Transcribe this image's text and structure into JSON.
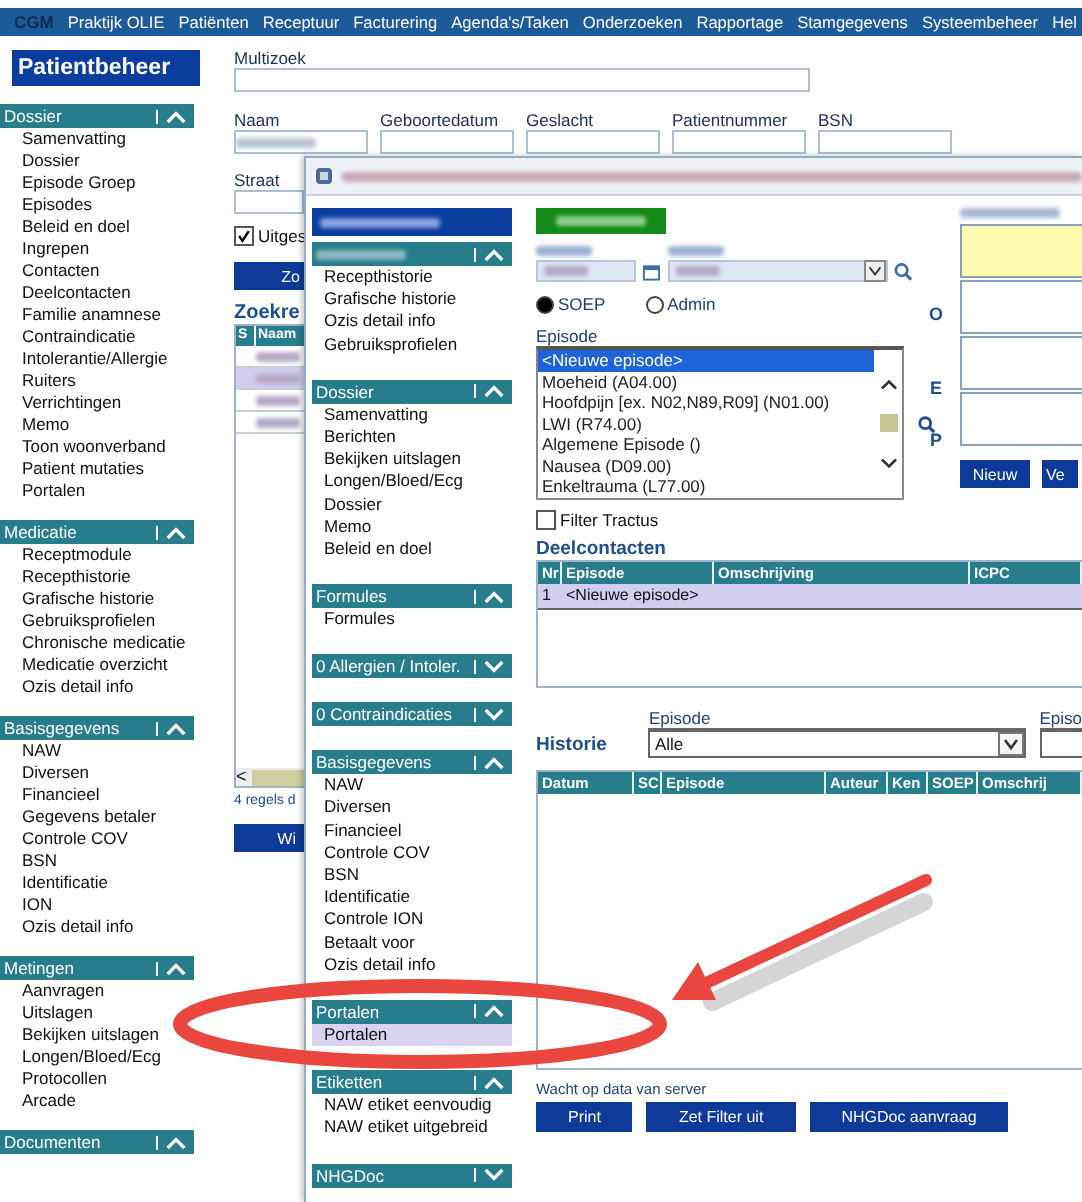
{
  "menu": {
    "logo": "CGM",
    "items": [
      "Praktijk OLIE",
      "Patiënten",
      "Receptuur",
      "Facturering",
      "Agenda's/Taken",
      "Onderzoeken",
      "Rapportage",
      "Stamgegevens",
      "Systeembeheer",
      "Hel"
    ]
  },
  "sidebar": {
    "title": "Patientbeheer",
    "sections": [
      {
        "title": "Dossier",
        "expanded": true,
        "items": [
          "Samenvatting",
          "Dossier",
          "Episode Groep",
          "Episodes",
          "Beleid en doel",
          "Ingrepen",
          "Contacten",
          "Deelcontacten",
          "Familie anamnese",
          "Contraindicatie",
          "Intolerantie/Allergie",
          "Ruiters",
          "Verrichtingen",
          "Memo",
          "Toon woonverband",
          "Patient mutaties",
          "Portalen"
        ]
      },
      {
        "title": "Medicatie",
        "expanded": true,
        "items": [
          "Receptmodule",
          "Recepthistorie",
          "Grafische historie",
          "Gebruiksprofielen",
          "Chronische medicatie",
          "Medicatie overzicht",
          "Ozis detail info"
        ]
      },
      {
        "title": "Basisgegevens",
        "expanded": true,
        "items": [
          "NAW",
          "Diversen",
          "Financieel",
          "Gegevens betaler",
          "Controle COV",
          "BSN",
          "Identificatie",
          "ION",
          "Ozis detail info"
        ]
      },
      {
        "title": "Metingen",
        "expanded": true,
        "items": [
          "Aanvragen",
          "Uitslagen",
          "Bekijken uitslagen",
          "Longen/Bloed/Ecg",
          "Protocollen",
          "Arcade"
        ]
      },
      {
        "title": "Documenten",
        "expanded": true
      }
    ]
  },
  "search": {
    "multizoek_label": "Multizoek",
    "fields": [
      {
        "label": "Naam"
      },
      {
        "label": "Geboortedatum"
      },
      {
        "label": "Geslacht"
      },
      {
        "label": "Patientnummer"
      },
      {
        "label": "BSN"
      }
    ],
    "straat_label": "Straat",
    "checkbox": {
      "label": "Uitges",
      "checked": true
    },
    "search_button": "Zo",
    "results_title": "Zoekre",
    "columns": [
      "S",
      "Naam"
    ],
    "rows": [
      {
        "selected": false
      },
      {
        "selected": true
      },
      {
        "selected": false
      },
      {
        "selected": false
      }
    ],
    "scroll_arrow": "<",
    "footer": "4 regels d",
    "bottom_button": "Wi"
  },
  "dialog": {
    "sections": [
      {
        "expanded": true,
        "items": [
          {
            "label": "Recepthistorie",
            "selected": false
          },
          {
            "label": "Grafische historie",
            "selected": false
          },
          {
            "label": "Ozis detail info",
            "selected": false
          },
          {
            "label": "Gebruiksprofielen",
            "selected": false
          }
        ]
      },
      {
        "title": "Dossier",
        "expanded": true,
        "items": [
          {
            "label": "Samenvatting",
            "selected": false
          },
          {
            "label": "Berichten",
            "selected": false
          },
          {
            "label": "Bekijken uitslagen",
            "selected": false
          },
          {
            "label": "Longen/Bloed/Ecg",
            "selected": false
          },
          {
            "label": "Dossier",
            "selected": false
          },
          {
            "label": "Memo",
            "selected": false
          },
          {
            "label": "Beleid en doel",
            "selected": false
          }
        ]
      },
      {
        "title": "Formules",
        "expanded": true,
        "items": [
          {
            "label": "Formules",
            "selected": false
          }
        ]
      },
      {
        "title": "0 Allergien / Intoler.",
        "expanded": false
      },
      {
        "title": "0 Contraindicaties",
        "expanded": false
      },
      {
        "title": "Basisgegevens",
        "expanded": true,
        "items": [
          {
            "label": "NAW",
            "selected": false
          },
          {
            "label": "Diversen",
            "selected": false
          },
          {
            "label": "Financieel",
            "selected": false
          },
          {
            "label": "Controle COV",
            "selected": false
          },
          {
            "label": "BSN",
            "selected": false
          },
          {
            "label": "Identificatie",
            "selected": false
          },
          {
            "label": "Controle ION",
            "selected": false
          },
          {
            "label": "Betaalt voor",
            "selected": false
          },
          {
            "label": "Ozis detail info",
            "selected": false
          }
        ]
      },
      {
        "title": "Portalen",
        "expanded": true,
        "items": [
          {
            "label": "Portalen",
            "selected": true
          }
        ]
      },
      {
        "title": "Etiketten",
        "expanded": true,
        "items": [
          {
            "label": "NAW etiket eenvoudig",
            "selected": false
          },
          {
            "label": "NAW etiket uitgebreid",
            "selected": false
          }
        ]
      },
      {
        "title": "NHGDoc",
        "expanded": false
      }
    ],
    "mode_options": [
      {
        "label": "SOEP",
        "selected": true
      },
      {
        "label": "Admin",
        "selected": false
      }
    ],
    "episode_label": "Episode",
    "episodes": [
      {
        "label": "<Nieuwe episode>",
        "selected": true
      },
      {
        "label": "Moeheid (A04.00)",
        "selected": false
      },
      {
        "label": "Hoofdpijn [ex. N02,N89,R09] (N01.00)",
        "selected": false
      },
      {
        "label": "LWI (R74.00)",
        "selected": false
      },
      {
        "label": "Algemene Episode ()",
        "selected": false
      },
      {
        "label": "Nausea (D09.00)",
        "selected": false
      },
      {
        "label": "Enkeltrauma (L77.00)",
        "selected": false
      }
    ],
    "soep_letters": [
      "O",
      "E",
      "P"
    ],
    "new_button": "Nieuw",
    "next_button": "Ve",
    "filter": {
      "label": "Filter Tractus",
      "checked": false
    },
    "deelcontacten": {
      "title": "Deelcontacten",
      "columns": [
        "Nr",
        "Episode",
        "Omschrijving",
        "ICPC"
      ],
      "rows": [
        {
          "cells": [
            "1",
            "<Nieuwe episode>",
            "",
            ""
          ],
          "selected": true
        }
      ]
    },
    "historie": {
      "title": "Historie",
      "episode_label": "Episode",
      "episode_value": "Alle",
      "second_label": "Episo",
      "columns": [
        "Datum",
        "SC",
        "Episode",
        "Auteur",
        "Ken",
        "SOEP",
        "Omschrij"
      ]
    },
    "status": "Wacht op data van server",
    "buttons": [
      "Print",
      "Zet Filter uit",
      "NHGDoc aanvraag"
    ]
  }
}
